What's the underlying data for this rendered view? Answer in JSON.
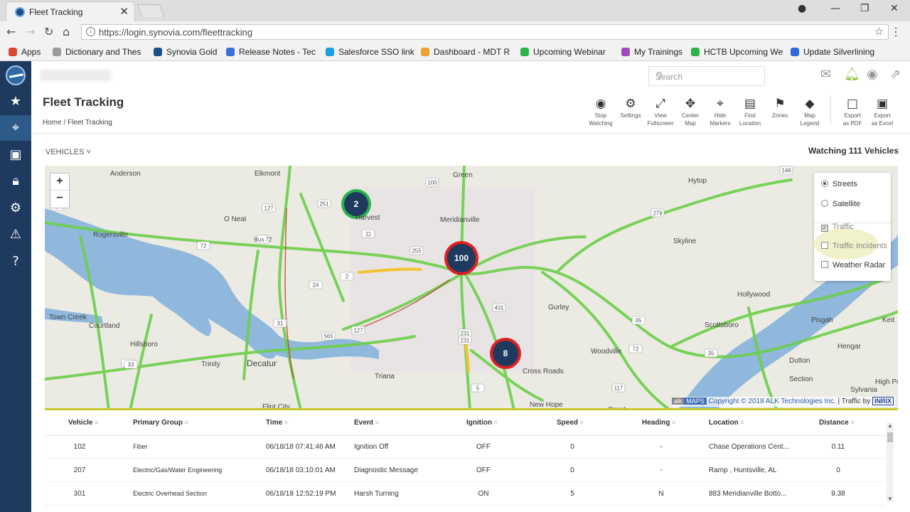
{
  "browser": {
    "tab_title": "Fleet Tracking",
    "url": "https://login.synovia.com/fleettracking",
    "bookmarks": [
      {
        "label": "Apps",
        "color": "#d9452f"
      },
      {
        "label": "Dictionary and Thes",
        "color": "#9a9a9a"
      },
      {
        "label": "Synovia Gold",
        "color": "#1b4f86"
      },
      {
        "label": "Release Notes - Tec",
        "color": "#3b6ed6"
      },
      {
        "label": "Salesforce SSO link",
        "color": "#1a9ee0"
      },
      {
        "label": "Dashboard - MDT R",
        "color": "#f0a030"
      },
      {
        "label": "Upcoming Webinar",
        "color": "#2bb34a"
      },
      {
        "label": "My Trainings",
        "color": "#a04ac0"
      },
      {
        "label": "HCTB Upcoming We",
        "color": "#2bb34a"
      },
      {
        "label": "Update Silverlining",
        "color": "#2f6ad8"
      }
    ]
  },
  "header": {
    "search_placeholder": "Search",
    "page_title": "Fleet Tracking",
    "breadcrumb": "Home / Fleet Tracking"
  },
  "toolbar": [
    {
      "icon": "eye-slash-icon",
      "glyph": "◉",
      "line1": "Stop",
      "line2": "Watching"
    },
    {
      "icon": "gears-icon",
      "glyph": "⚙",
      "line1": "Settings",
      "line2": ""
    },
    {
      "icon": "expand-icon",
      "glyph": "⤢",
      "line1": "View",
      "line2": "Fullscreen"
    },
    {
      "icon": "crosshair-icon",
      "glyph": "✥",
      "line1": "Center",
      "line2": "Map"
    },
    {
      "icon": "map-marker-icon",
      "glyph": "⌖",
      "line1": "Hide",
      "line2": "Markers"
    },
    {
      "icon": "map-icon",
      "glyph": "▤",
      "line1": "Find",
      "line2": "Location"
    },
    {
      "icon": "flag-icon",
      "glyph": "⚑",
      "line1": "Zones",
      "line2": ""
    },
    {
      "icon": "tag-icon",
      "glyph": "◆",
      "line1": "Map",
      "line2": "Legend"
    },
    {
      "icon": "pdf-file-icon",
      "glyph": "□",
      "line1": "Export",
      "line2": "as PDF"
    },
    {
      "icon": "excel-file-icon",
      "glyph": "▣",
      "line1": "Export",
      "line2": "as Excel"
    }
  ],
  "vehicles_bar": {
    "dropdown_label": "VEHICLES ˅",
    "watching": "Watching 111 Vehicles"
  },
  "map": {
    "zoom_in": "+",
    "zoom_out": "−",
    "layers": [
      {
        "label": "Streets",
        "type": "radio",
        "checked": true
      },
      {
        "label": "Satellite",
        "type": "radio",
        "checked": false
      },
      {
        "label": "Traffic",
        "type": "checkbox",
        "checked": true
      },
      {
        "label": "Traffic Incidents",
        "type": "checkbox",
        "checked": false
      },
      {
        "label": "Weather Radar",
        "type": "checkbox",
        "checked": false
      }
    ],
    "clusters": [
      "2",
      "100",
      "8"
    ],
    "places": [
      "Anderson",
      "Elkmont",
      "Green",
      "Hytop",
      "Rogersville",
      "O Neal",
      "Harvest",
      "Meridianville",
      "Skyline",
      "Town Creek",
      "Courtland",
      "Hillsboro",
      "Trinity",
      "Decatur",
      "Triana",
      "Gurley",
      "Hollywood",
      "Woodville",
      "Scottsboro",
      "Pisgah",
      "Dutton",
      "Section",
      "Hengar",
      "High Point",
      "Sylvania",
      "Cross Roads",
      "New Hope",
      "Grant",
      "Priceville",
      "Flint City",
      "Langston",
      "Ste",
      "Keit"
    ],
    "route_shields": [
      "100",
      "127",
      "72",
      "Bus 72",
      "251",
      "11",
      "255",
      "2",
      "24",
      "431",
      "231",
      "31",
      "565",
      "127",
      "20",
      "33",
      "231",
      "35",
      "72",
      "35",
      "279",
      "146",
      "117",
      "5",
      "8",
      "67"
    ],
    "copyright_alk": "alk",
    "copyright_maps": "MAPS",
    "copyright_text": "Copyright © 2018 ALK Technologies Inc.",
    "traffic_by": "| Traffic by",
    "inrix": "INRIX"
  },
  "grid": {
    "columns": [
      "Vehicle",
      "Primary Group",
      "Time",
      "Event",
      "Ignition",
      "Speed",
      "Heading",
      "Location",
      "Distance"
    ],
    "rows": [
      [
        "102",
        "Fiber",
        "06/18/18 07:41:46 AM",
        "Ignition Off",
        "OFF",
        "0",
        "-",
        "Chase Operations Cent...",
        "0.11"
      ],
      [
        "207",
        "Electric/Gas/Water Engineering",
        "06/18/18 03:10:01 AM",
        "Diagnostic Message",
        "OFF",
        "0",
        "-",
        "Ramp , Huntsville, AL",
        "0"
      ],
      [
        "301",
        "Electric Overhead Section",
        "06/18/18 12:52:19 PM",
        "Harsh Turning",
        "ON",
        "5",
        "N",
        "883 Meridianville Botto...",
        "9.38"
      ]
    ]
  },
  "colors": {
    "sidebar": "#1e3a5f",
    "traffic_green": "#6ccf4a",
    "water": "#8fb8dc",
    "cluster_ring_red": "#e02020",
    "cluster_fill": "#1e3a5f"
  }
}
